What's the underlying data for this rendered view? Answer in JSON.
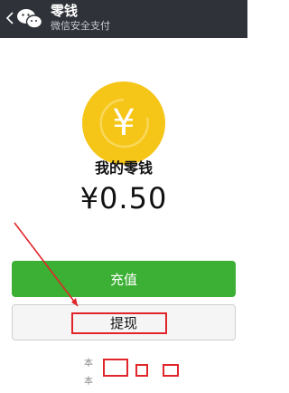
{
  "topbar": {
    "back_icon": "chevron-left-icon",
    "logo_icon": "wechat-logo",
    "title": "零钱",
    "subtitle": "微信安全支付"
  },
  "wallet": {
    "coin_symbol": "¥",
    "label": "我的零钱",
    "balance": "¥0.50"
  },
  "actions": {
    "recharge_label": "充值",
    "withdraw_label": "提现"
  },
  "footer": {
    "partial_text_1": "本",
    "partial_text_2": "本"
  },
  "colors": {
    "topbar": "#2f3238",
    "coin": "#f5c518",
    "recharge": "#3cb034",
    "annotation": "#e0252b"
  }
}
